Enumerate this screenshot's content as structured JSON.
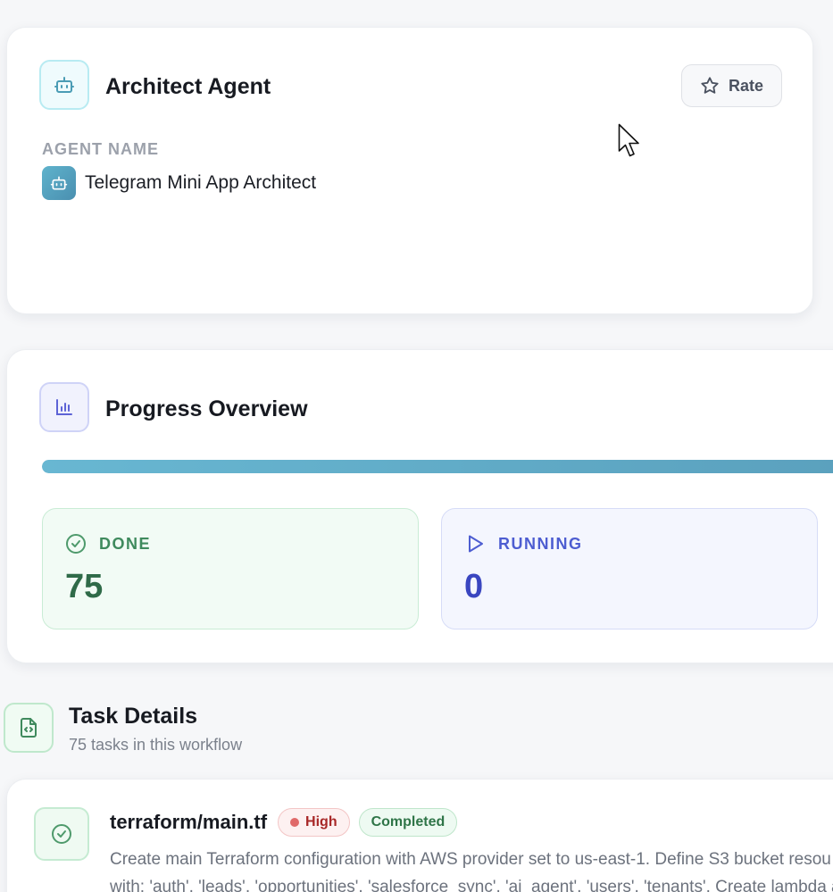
{
  "agent_card": {
    "title": "Architect Agent",
    "rate_label": "Rate",
    "agent_name_label": "AGENT NAME",
    "agent_name": "Telegram Mini App Architect"
  },
  "progress": {
    "title": "Progress Overview",
    "percent_complete": 100,
    "done_label": "DONE",
    "done_count": "75",
    "running_label": "RUNNING",
    "running_count": "0"
  },
  "task_details": {
    "title": "Task Details",
    "subtitle": "75 tasks in this workflow",
    "tasks": [
      {
        "file": "terraform/main.tf",
        "priority": "High",
        "status": "Completed",
        "description": "Create main Terraform configuration with AWS provider set to us-east-1. Define S3 bucket resou\nwith: 'auth', 'leads', 'opportunities', 'salesforce_sync', 'ai_agent', 'users', 'tenants'. Create lambda a"
      }
    ]
  },
  "colors": {
    "agent_accent": "#4a8fb0",
    "progress_accent": "#5aa0bd",
    "done_green": "#3f8a5d",
    "running_blue": "#4d5dd1",
    "priority_high": "#a82828"
  },
  "icons": {
    "agent": "robot-icon",
    "rate": "star-icon",
    "progress": "bar-chart-icon",
    "done": "check-circle-icon",
    "running": "play-icon",
    "task_details": "code-file-icon",
    "task_status": "check-circle-icon"
  }
}
